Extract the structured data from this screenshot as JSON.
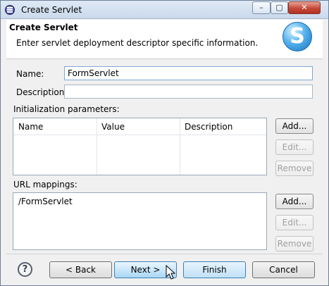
{
  "window": {
    "title": "Create Servlet",
    "min_label": "–",
    "max_label": "▢",
    "close_label": "✕"
  },
  "header": {
    "title": "Create Servlet",
    "message": "Enter servlet deployment descriptor specific information.",
    "logo_letter": "S"
  },
  "form": {
    "name_label": "Name:",
    "name_value": "FormServlet",
    "description_label": "Description:",
    "description_value": ""
  },
  "init_params": {
    "label": "Initialization parameters:",
    "columns": [
      "Name",
      "Value",
      "Description"
    ],
    "add_label": "Add...",
    "edit_label": "Edit...",
    "remove_label": "Remove"
  },
  "url_mappings": {
    "label": "URL mappings:",
    "items": [
      "/FormServlet"
    ],
    "add_label": "Add...",
    "edit_label": "Edit...",
    "remove_label": "Remove"
  },
  "footer": {
    "help_label": "?",
    "back_label": "< Back",
    "next_label": "Next >",
    "finish_label": "Finish",
    "cancel_label": "Cancel"
  }
}
